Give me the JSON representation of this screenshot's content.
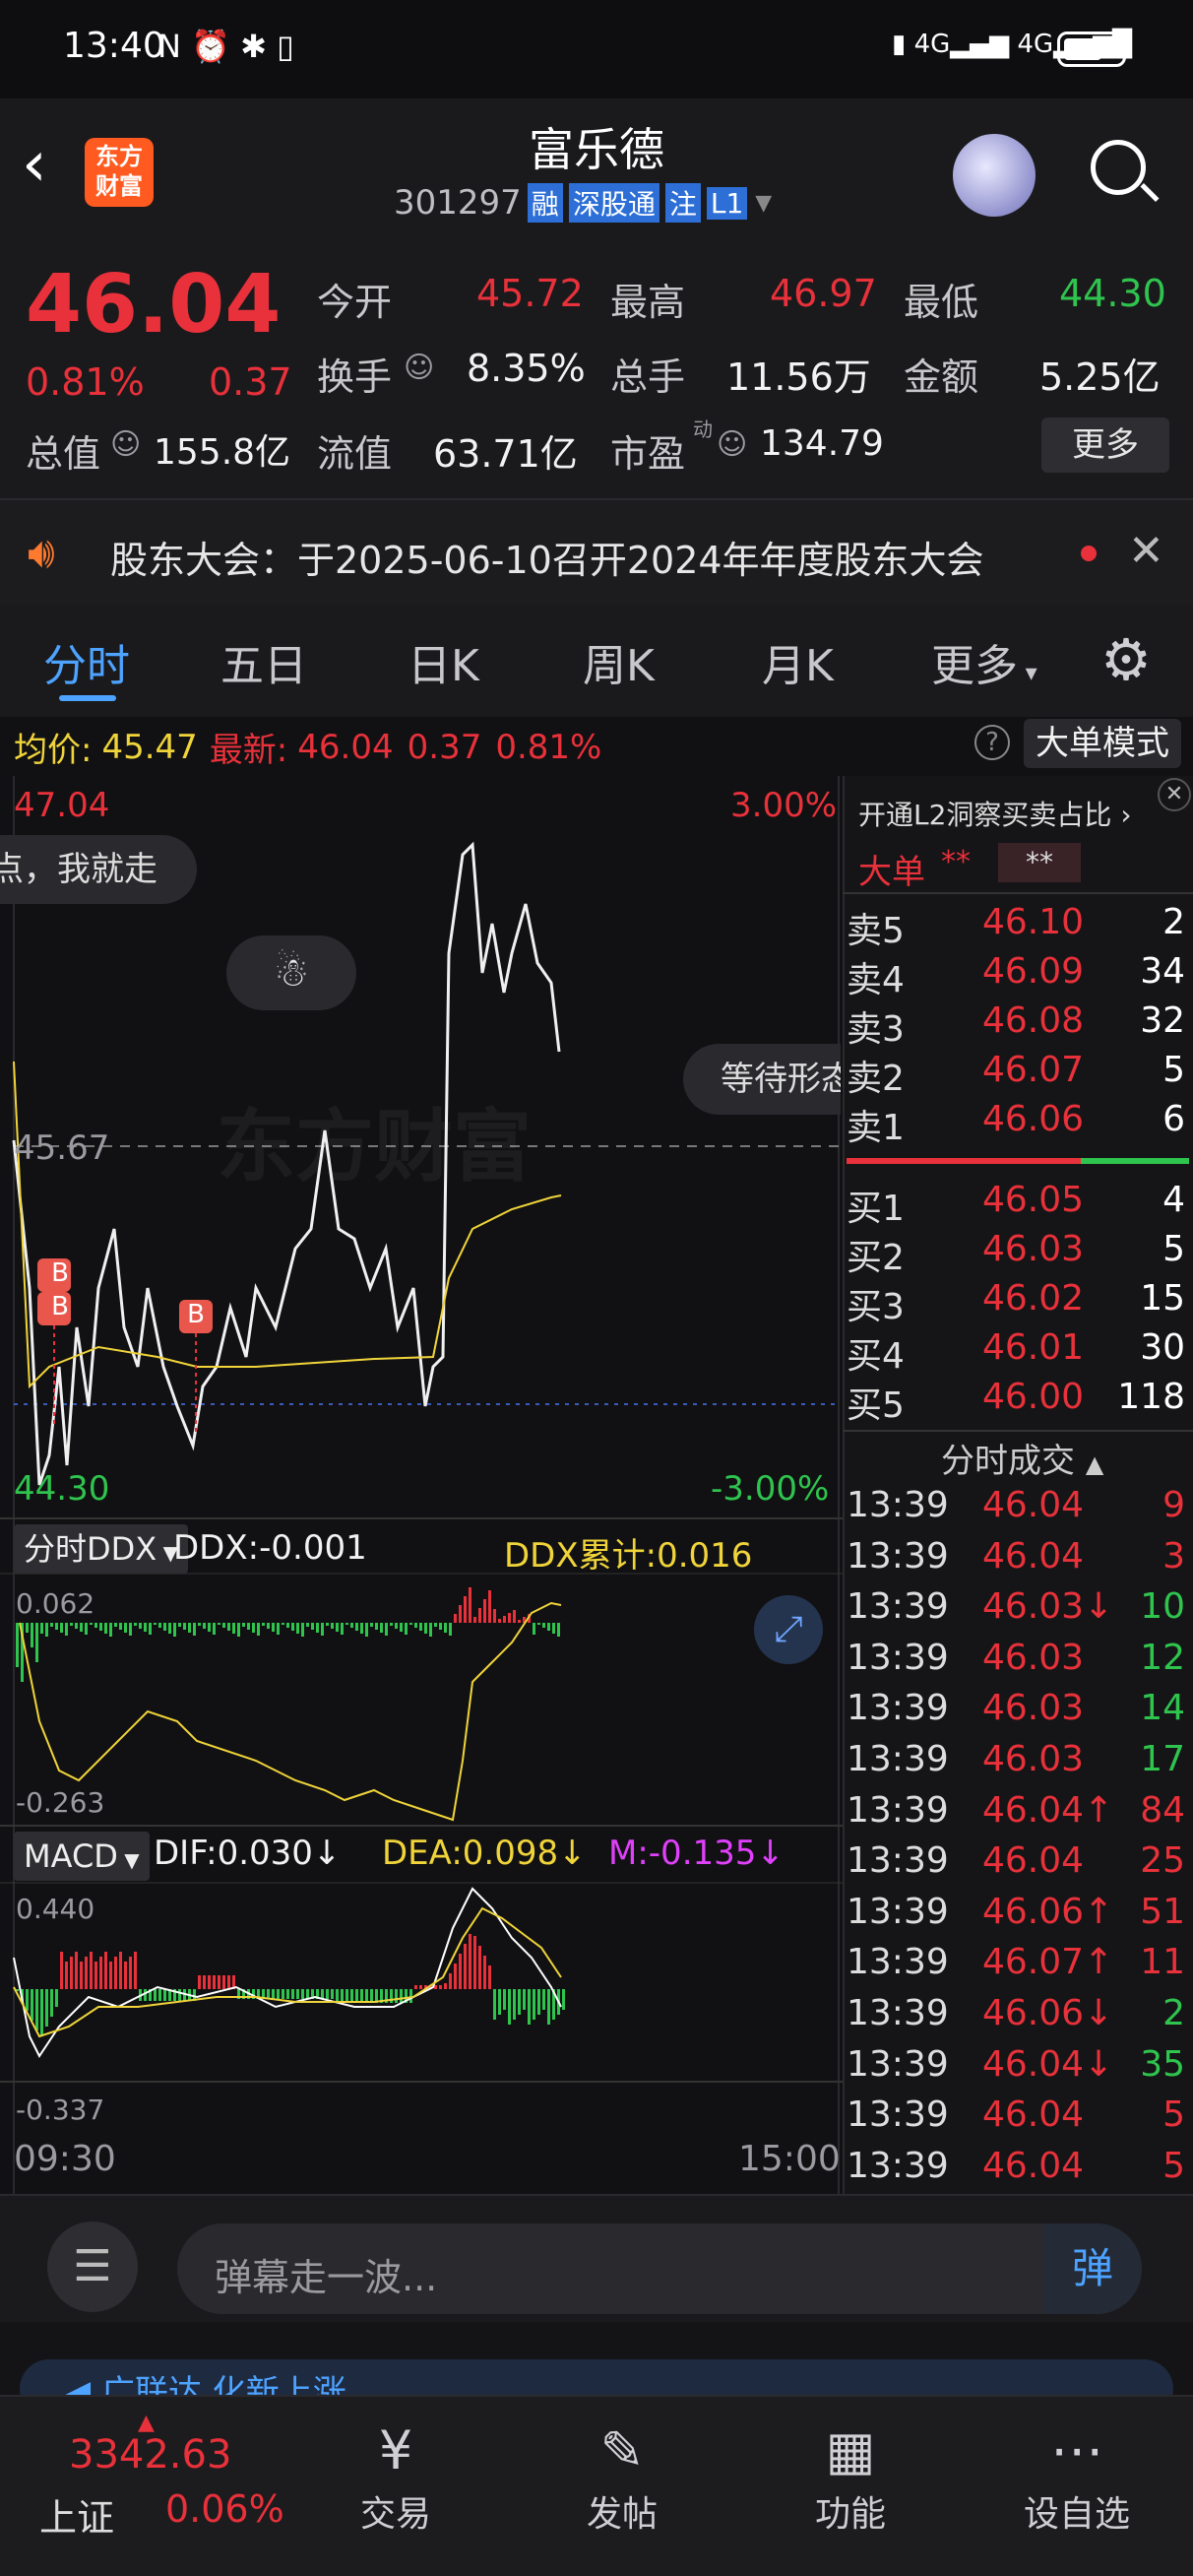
{
  "status_bar": {
    "time": "13:40",
    "icons": "N ⏰ ✱ ▯",
    "network": "4G 4G"
  },
  "header": {
    "title": "富乐德",
    "code": "301297",
    "tags": [
      "融",
      "深股通",
      "注",
      "L1"
    ],
    "logo_text": "东方财富"
  },
  "quote": {
    "price": "46.04",
    "change_pct": "0.81%",
    "change": "0.37",
    "open_label": "今开",
    "open": "45.72",
    "high_label": "最高",
    "high": "46.97",
    "low_label": "最低",
    "low": "44.30",
    "turnover_label": "换手",
    "turnover": "8.35%",
    "volume_label": "总手",
    "volume": "11.56万",
    "amount_label": "金额",
    "amount": "5.25亿",
    "mktcap_label": "总值",
    "mktcap": "155.8亿",
    "float_label": "流值",
    "float": "63.71亿",
    "pe_label": "市盈",
    "pe_sup": "动",
    "pe": "134.79",
    "more_button": "更多"
  },
  "notice": {
    "text": "股东大会：于2025-06-10召开2024年年度股东大会"
  },
  "tabs": [
    "分时",
    "五日",
    "日K",
    "周K",
    "月K",
    "更多"
  ],
  "chart": {
    "avg_label": "均价:",
    "avg": "45.47",
    "latest_label": "最新:",
    "latest": "46.04",
    "latest_chg": "0.37",
    "latest_pct": "0.81%",
    "big_order_button": "大单模式",
    "top_price": "47.04",
    "top_pct": "3.00%",
    "mid_price": "45.67",
    "bottom_price": "44.30",
    "bottom_pct": "-3.00%",
    "bubble_text": "点，我就走",
    "bubble_wait": "等待形态",
    "watermark": "东方财富",
    "ddx_selector": "分时DDX",
    "ddx": "DDX:-0.001",
    "ddx_cum": "DDX累计:0.016",
    "ddx_top": "0.062",
    "ddx_bottom": "-0.263",
    "macd_selector": "MACD",
    "dif": "DIF:0.030↓",
    "dea": "DEA:0.098↓",
    "m": "M:-0.135↓",
    "macd_top": "0.440",
    "macd_bottom": "-0.337",
    "time_start": "09:30",
    "time_end": "15:00",
    "b_marker": "B"
  },
  "orderbook": {
    "promo": "开通L2洞察买卖占比",
    "big_order": "大单",
    "stars1": "**",
    "stars2": "**",
    "asks": [
      {
        "label": "卖5",
        "price": "46.10",
        "vol": "2"
      },
      {
        "label": "卖4",
        "price": "46.09",
        "vol": "34"
      },
      {
        "label": "卖3",
        "price": "46.08",
        "vol": "32"
      },
      {
        "label": "卖2",
        "price": "46.07",
        "vol": "5"
      },
      {
        "label": "卖1",
        "price": "46.06",
        "vol": "6"
      }
    ],
    "bids": [
      {
        "label": "买1",
        "price": "46.05",
        "vol": "4"
      },
      {
        "label": "买2",
        "price": "46.03",
        "vol": "5"
      },
      {
        "label": "买3",
        "price": "46.02",
        "vol": "15"
      },
      {
        "label": "买4",
        "price": "46.01",
        "vol": "30"
      },
      {
        "label": "买5",
        "price": "46.00",
        "vol": "118"
      }
    ]
  },
  "trades": {
    "header": "分时成交",
    "rows": [
      {
        "t": "13:39",
        "p": "46.04",
        "v": "9",
        "vc": "red"
      },
      {
        "t": "13:39",
        "p": "46.04",
        "v": "3",
        "vc": "red"
      },
      {
        "t": "13:39",
        "p": "46.03↓",
        "v": "10",
        "vc": "green"
      },
      {
        "t": "13:39",
        "p": "46.03",
        "v": "12",
        "vc": "green"
      },
      {
        "t": "13:39",
        "p": "46.03",
        "v": "14",
        "vc": "green"
      },
      {
        "t": "13:39",
        "p": "46.03",
        "v": "17",
        "vc": "green"
      },
      {
        "t": "13:39",
        "p": "46.04↑",
        "v": "84",
        "vc": "red"
      },
      {
        "t": "13:39",
        "p": "46.04",
        "v": "25",
        "vc": "red"
      },
      {
        "t": "13:39",
        "p": "46.06↑",
        "v": "51",
        "vc": "red"
      },
      {
        "t": "13:39",
        "p": "46.07↑",
        "v": "11",
        "vc": "red"
      },
      {
        "t": "13:39",
        "p": "46.06↓",
        "v": "2",
        "vc": "green"
      },
      {
        "t": "13:39",
        "p": "46.04↓",
        "v": "35",
        "vc": "green"
      },
      {
        "t": "13:39",
        "p": "46.04",
        "v": "5",
        "vc": "red"
      },
      {
        "t": "13:39",
        "p": "46.04",
        "v": "5",
        "vc": "red"
      }
    ]
  },
  "comment": {
    "placeholder": "弹幕走一波...",
    "send_icon": "弹"
  },
  "ticker": {
    "text": "◀ 广联达 化新上涨..."
  },
  "bottom_nav": {
    "index_value": "3342.63",
    "index_name": "上证",
    "index_pct": "0.06%",
    "items": [
      "交易",
      "发帖",
      "功能",
      "设自选"
    ]
  }
}
